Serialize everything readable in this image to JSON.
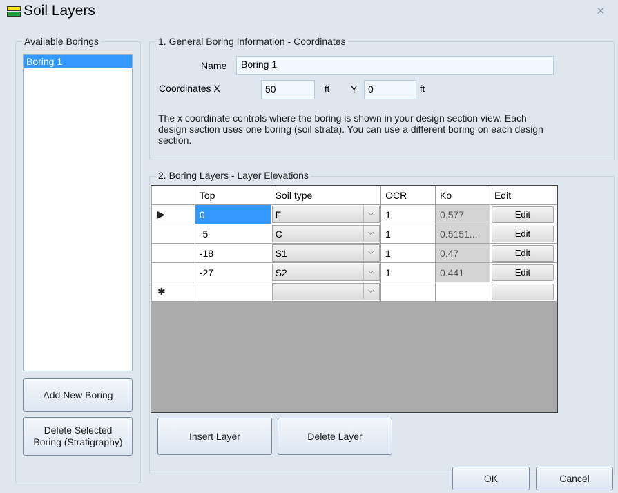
{
  "window": {
    "title": "Soil Layers",
    "close_glyph": "✕"
  },
  "borings": {
    "label": "Available Borings",
    "items": [
      "Boring 1"
    ],
    "add_button": "Add New Boring",
    "delete_button_line1": "Delete Selected",
    "delete_button_line2": "Boring (Stratigraphy)"
  },
  "general": {
    "label": "1. General Boring Information - Coordinates",
    "name_label": "Name",
    "name_value": "Boring 1",
    "coord_x_label": "Coordinates X",
    "x_value": "50",
    "x_unit": "ft",
    "y_label": "Y",
    "y_value": "0",
    "y_unit": "ft",
    "info_text": "The x coordinate controls where the boring is shown in your design section view. Each design section uses one boring (soil strata). You can use a different boring on each design section."
  },
  "layers": {
    "label": "2. Boring Layers - Layer Elevations",
    "columns": [
      "Top",
      "Soil type",
      "OCR",
      "Ko",
      "Edit"
    ],
    "rows": [
      {
        "top": "0",
        "soil": "F",
        "ocr": "1",
        "ko": "0.577",
        "edit": "Edit"
      },
      {
        "top": "-5",
        "soil": "C",
        "ocr": "1",
        "ko": "0.5151...",
        "edit": "Edit"
      },
      {
        "top": "-18",
        "soil": "S1",
        "ocr": "1",
        "ko": "0.47",
        "edit": "Edit"
      },
      {
        "top": "-27",
        "soil": "S2",
        "ocr": "1",
        "ko": "0.441",
        "edit": "Edit"
      }
    ],
    "current_row_glyph": "▶",
    "new_row_glyph": "✱",
    "insert_button": "Insert Layer",
    "delete_button": "Delete Layer"
  },
  "footer": {
    "ok": "OK",
    "cancel": "Cancel"
  },
  "colors": {
    "selection": "#3399ff",
    "window_bg": "#dfe6ee"
  }
}
